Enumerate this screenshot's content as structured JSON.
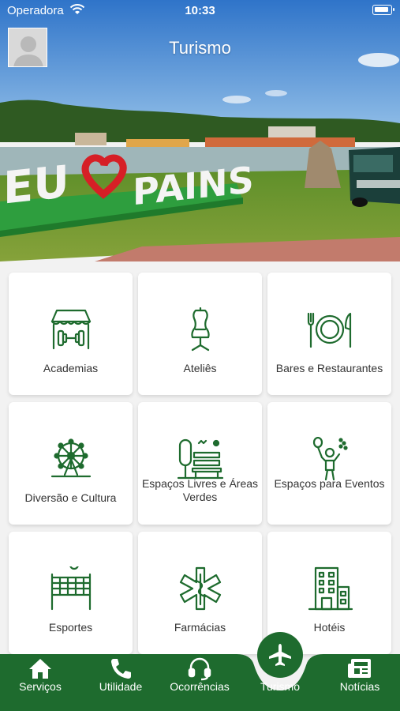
{
  "status_bar": {
    "carrier": "Operadora",
    "time": "10:33"
  },
  "header": {
    "title": "Turismo"
  },
  "hero_sign": "EU PAINS",
  "colors": {
    "primary": "#1e6b2e",
    "icon": "#1e6b2e",
    "card": "#ffffff"
  },
  "categories": [
    {
      "label": "Academias",
      "icon": "gym-icon"
    },
    {
      "label": "Ateliês",
      "icon": "mannequin-icon"
    },
    {
      "label": "Bares e Restaurantes",
      "icon": "plate-cutlery-icon"
    },
    {
      "label": "Diversão e Cultura",
      "icon": "ferris-wheel-icon"
    },
    {
      "label": "Espaços Livres e Áreas Verdes",
      "icon": "park-bench-tree-icon"
    },
    {
      "label": "Espaços para Eventos",
      "icon": "balloon-person-icon"
    },
    {
      "label": "Esportes",
      "icon": "volleyball-net-icon"
    },
    {
      "label": "Farmácias",
      "icon": "medical-star-icon"
    },
    {
      "label": "Hotéis",
      "icon": "hotel-building-icon"
    }
  ],
  "tabs": [
    {
      "label": "Serviços",
      "icon": "home-icon"
    },
    {
      "label": "Utilidade",
      "icon": "phone-icon"
    },
    {
      "label": "Ocorrências",
      "icon": "headset-icon"
    },
    {
      "label": "Turismo",
      "icon": "airplane-icon",
      "active": true
    },
    {
      "label": "Notícias",
      "icon": "newspaper-icon"
    }
  ]
}
